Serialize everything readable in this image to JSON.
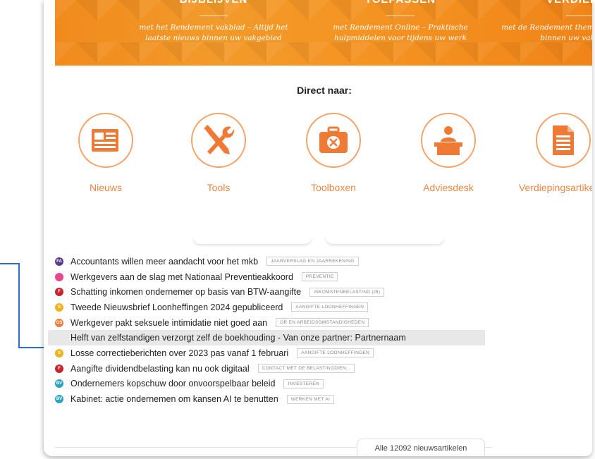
{
  "banner": {
    "columns": [
      {
        "title": "BIJBLIJVEN",
        "desc": "met het Rendement vakblad – Altijd het laatste nieuws binnen uw vakgebied"
      },
      {
        "title": "TOEPASSEN",
        "desc": "met Rendement Online – Praktische hulpmiddelen voor tijdens uw werk"
      },
      {
        "title": "VERDIEPEN",
        "desc": "met de Rendement thema's – Alle thema's binnen uw vakgebied"
      }
    ]
  },
  "direct": {
    "heading": "Direct naar:",
    "items": [
      {
        "label": "Nieuws",
        "icon": "newspaper-icon"
      },
      {
        "label": "Tools",
        "icon": "tools-icon"
      },
      {
        "label": "Toolboxen",
        "icon": "toolbox-icon"
      },
      {
        "label": "Adviesdesk",
        "icon": "helpdesk-icon"
      },
      {
        "label": "Verdiepingsartikelen",
        "icon": "document-icon"
      }
    ]
  },
  "colors": {
    "accent": "#ef8644",
    "circle_border": "#f4a36a",
    "arrow": "#2a6fc1",
    "highlight_row": "#e8e8e8"
  },
  "news": {
    "items": [
      {
        "badge": "FA",
        "color": "#5b3a8c",
        "title": "Accountants willen meer aandacht voor het mkb",
        "tag": "JAARVERSLAG EN JAARREKENING"
      },
      {
        "badge": "",
        "color": "#e8488b",
        "title": "Werkgevers aan de slag met Nationaal Preventieakkoord",
        "tag": "PREVENTIE"
      },
      {
        "badge": "F",
        "color": "#c8242f",
        "title": "Schatting inkomen ondernemer op basis van BTW-aangifte",
        "tag": "INKOMSTENBELASTING (IB)"
      },
      {
        "badge": "S",
        "color": "#f2b21c",
        "title": "Tweede Nieuwsbrief Loonheffingen 2024 gepubliceerd",
        "tag": "AANGIFTE LOONHEFFINGEN"
      },
      {
        "badge": "OS",
        "color": "#ef7e3a",
        "title": "Werkgever pakt seksuele intimidatie niet goed aan",
        "tag": "OR EN ARBEIDSOMSTANDIGHEDEN"
      },
      {
        "badge": "",
        "color": "#e8e8e8",
        "title": "Helft van zelfstandigen verzorgt zelf de boekhouding - Van onze partner: Partnernaam",
        "tag": "",
        "highlighted": true
      },
      {
        "badge": "S",
        "color": "#f2b21c",
        "title": "Losse correctieberichten over 2023 pas vanaf 1 februari",
        "tag": "AANGIFTE LOONHEFFINGEN"
      },
      {
        "badge": "F",
        "color": "#c8242f",
        "title": "Aangifte dividendbelasting kan nu ook digitaal",
        "tag": "CONTACT MET DE BELASTINGDIEN..."
      },
      {
        "badge": "BV",
        "color": "#2aa3c2",
        "title": "Ondernemers kopschuw door onvoorspelbaar beleid",
        "tag": "INVESTEREN"
      },
      {
        "badge": "BV",
        "color": "#2aa3c2",
        "title": "Kabinet: actie ondernemen om kansen AI te benutten",
        "tag": "WERKEN MET AI"
      }
    ],
    "all_button": "Alle 12092 nieuwsartikelen"
  }
}
